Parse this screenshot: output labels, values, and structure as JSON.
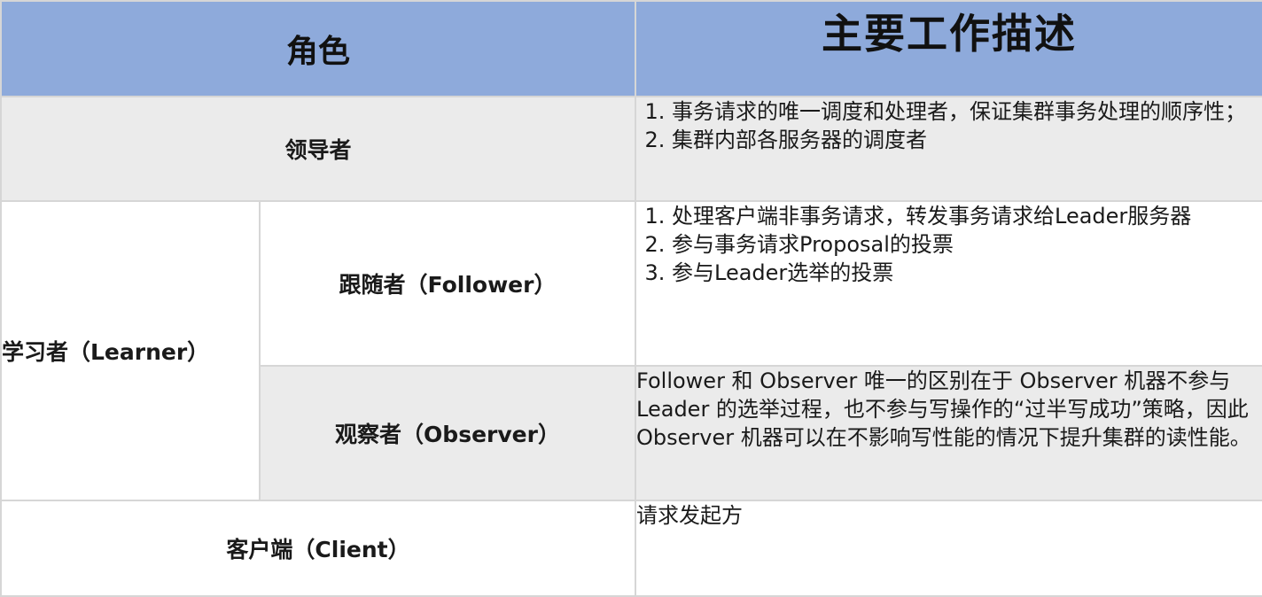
{
  "header": {
    "role": "角色",
    "description": "主要工作描述"
  },
  "rows": {
    "leader": {
      "role": "领导者",
      "items": [
        "事务请求的唯一调度和处理者，保证集群事务处理的顺序性；",
        "集群内部各服务器的调度者"
      ]
    },
    "learner": {
      "role": "学习者（Learner）",
      "follower": {
        "role": "跟随者（Follower）",
        "items": [
          "处理客户端非事务请求，转发事务请求给Leader服务器",
          "参与事务请求Proposal的投票",
          "参与Leader选举的投票"
        ]
      },
      "observer": {
        "role": "观察者（Observer）",
        "description": "Follower 和 Observer 唯一的区别在于 Observer 机器不参与 Leader 的选举过程，也不参与写操作的“过半写成功”策略，因此 Observer 机器可以在不影响写性能的情况下提升集群的读性能。"
      }
    },
    "client": {
      "role": "客户端（Client）",
      "description": "请求发起方"
    }
  },
  "colors": {
    "header_bg": "#8eaadb",
    "row_gray": "#ebebeb",
    "row_white": "#ffffff",
    "border": "#d6d6d6"
  }
}
